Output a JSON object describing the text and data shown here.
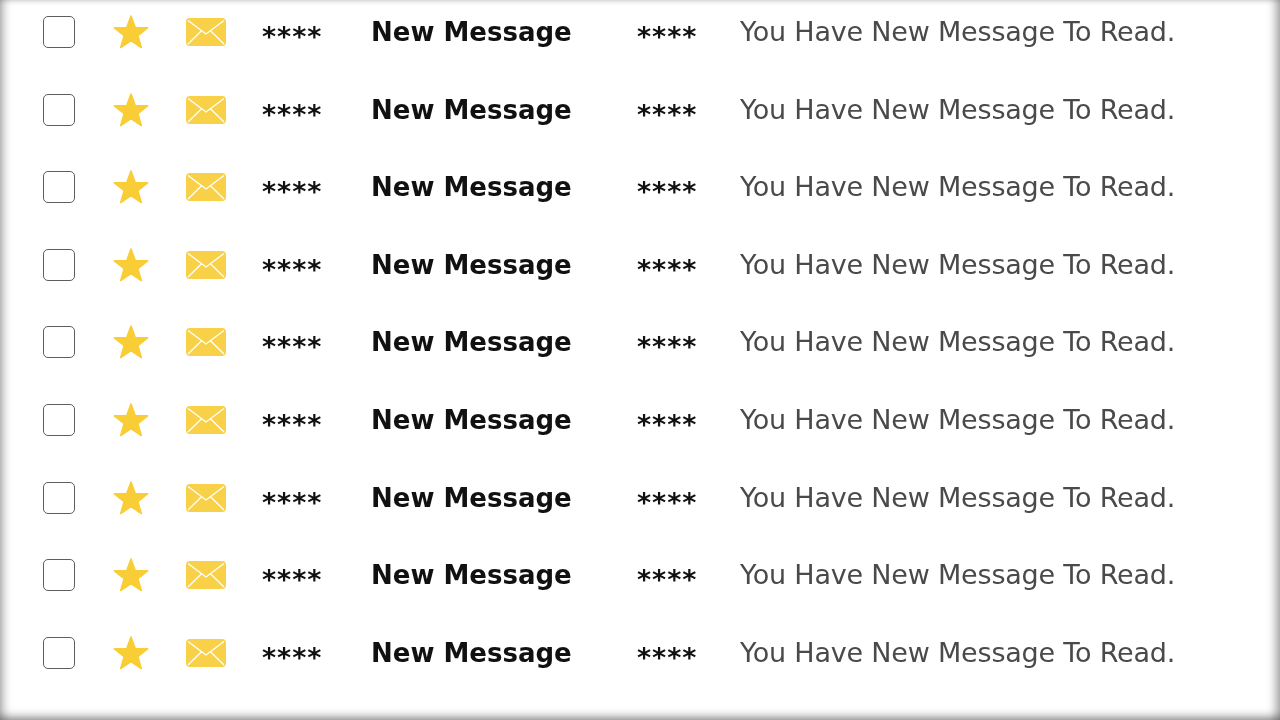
{
  "rows": [
    {
      "checked": false,
      "starred": true,
      "column_4": "****",
      "subject": "New Message",
      "column_6": "****",
      "preview": "You Have New Message To Read."
    },
    {
      "checked": false,
      "starred": true,
      "column_4": "****",
      "subject": "New Message",
      "column_6": "****",
      "preview": "You Have New Message To Read."
    },
    {
      "checked": false,
      "starred": true,
      "column_4": "****",
      "subject": "New Message",
      "column_6": "****",
      "preview": "You Have New Message To Read."
    },
    {
      "checked": false,
      "starred": true,
      "column_4": "****",
      "subject": "New Message",
      "column_6": "****",
      "preview": "You Have New Message To Read."
    },
    {
      "checked": false,
      "starred": true,
      "column_4": "****",
      "subject": "New Message",
      "column_6": "****",
      "preview": "You Have New Message To Read."
    },
    {
      "checked": false,
      "starred": true,
      "column_4": "****",
      "subject": "New Message",
      "column_6": "****",
      "preview": "You Have New Message To Read."
    },
    {
      "checked": false,
      "starred": true,
      "column_4": "****",
      "subject": "New Message",
      "column_6": "****",
      "preview": "You Have New Message To Read."
    },
    {
      "checked": false,
      "starred": true,
      "column_4": "****",
      "subject": "New Message",
      "column_6": "****",
      "preview": "You Have New Message To Read."
    },
    {
      "checked": false,
      "starred": true,
      "column_4": "****",
      "subject": "New Message",
      "column_6": "****",
      "preview": "You Have New Message To Read."
    }
  ]
}
